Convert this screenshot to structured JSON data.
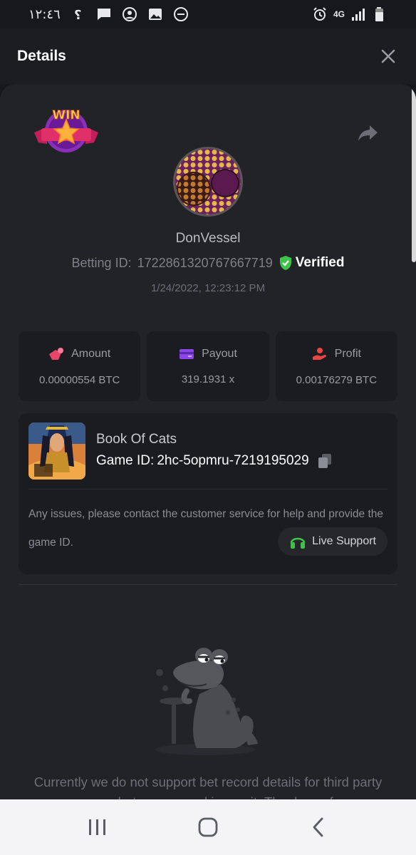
{
  "status_bar": {
    "time": "١٢:٤٦",
    "network": "4G",
    "icons": [
      "question-icon",
      "message-icon",
      "account-icon",
      "image-icon",
      "dnd-icon",
      "alarm-icon",
      "signal-icon",
      "battery-icon"
    ]
  },
  "header": {
    "title": "Details",
    "close_icon": "close-icon"
  },
  "bet": {
    "username": "DonVessel",
    "betting_id_label": "Betting ID:",
    "betting_id": "1722861320767667719",
    "verified_label": "Verified",
    "timestamp": "1/24/2022, 12:23:12 PM"
  },
  "stats": [
    {
      "label": "Amount",
      "value": "0.00000554 BTC",
      "icon": "amount-icon",
      "color": "#e8456a"
    },
    {
      "label": "Payout",
      "value": "319.1931 x",
      "icon": "payout-card-icon",
      "color": "#8b45e8"
    },
    {
      "label": "Profit",
      "value": "0.00176279 BTC",
      "icon": "profit-hand-icon",
      "color": "#e84545"
    }
  ],
  "game": {
    "title": "Book Of Cats",
    "id_label": "Game ID:",
    "id_value": "2hc-5opmru-7219195029",
    "notice": "Any issues, please contact the customer service for help and provide the game ID.",
    "support_label": "Live Support",
    "support_color": "#3fc24a"
  },
  "empty_state": {
    "text": "Currently we do not support bet record details for third party games, but we are working on it. Thank you for"
  },
  "colors": {
    "background": "#17181b",
    "sheet": "#222327",
    "card": "#1b1c1f",
    "verified": "#3fc24a"
  }
}
